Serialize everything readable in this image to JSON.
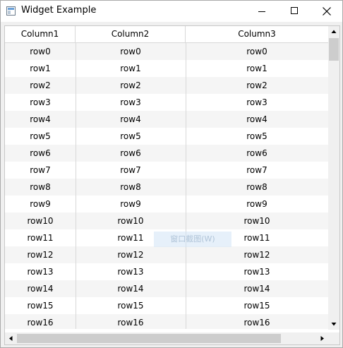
{
  "window": {
    "title": "Widget Example"
  },
  "table": {
    "columns": [
      "Column1",
      "Column2",
      "Column3"
    ],
    "rows": [
      [
        "row0",
        "row0",
        "row0"
      ],
      [
        "row1",
        "row1",
        "row1"
      ],
      [
        "row2",
        "row2",
        "row2"
      ],
      [
        "row3",
        "row3",
        "row3"
      ],
      [
        "row4",
        "row4",
        "row4"
      ],
      [
        "row5",
        "row5",
        "row5"
      ],
      [
        "row6",
        "row6",
        "row6"
      ],
      [
        "row7",
        "row7",
        "row7"
      ],
      [
        "row8",
        "row8",
        "row8"
      ],
      [
        "row9",
        "row9",
        "row9"
      ],
      [
        "row10",
        "row10",
        "row10"
      ],
      [
        "row11",
        "row11",
        "row11"
      ],
      [
        "row12",
        "row12",
        "row12"
      ],
      [
        "row13",
        "row13",
        "row13"
      ],
      [
        "row14",
        "row14",
        "row14"
      ],
      [
        "row15",
        "row15",
        "row15"
      ],
      [
        "row16",
        "row16",
        "row16"
      ]
    ]
  },
  "overlay": {
    "watermark_text": "窗口截图(W)"
  },
  "icons": {
    "app": "window-app-icon",
    "minimize": "minimize-icon",
    "maximize": "maximize-icon",
    "close": "close-icon",
    "scroll_up": "arrow-up-icon",
    "scroll_down": "arrow-down-icon",
    "scroll_left": "arrow-left-icon",
    "scroll_right": "arrow-right-icon"
  },
  "colors": {
    "row_alt": "#f5f5f5",
    "grid_line": "#d8d8d8",
    "scrollbar_thumb": "#cdcdcd"
  }
}
